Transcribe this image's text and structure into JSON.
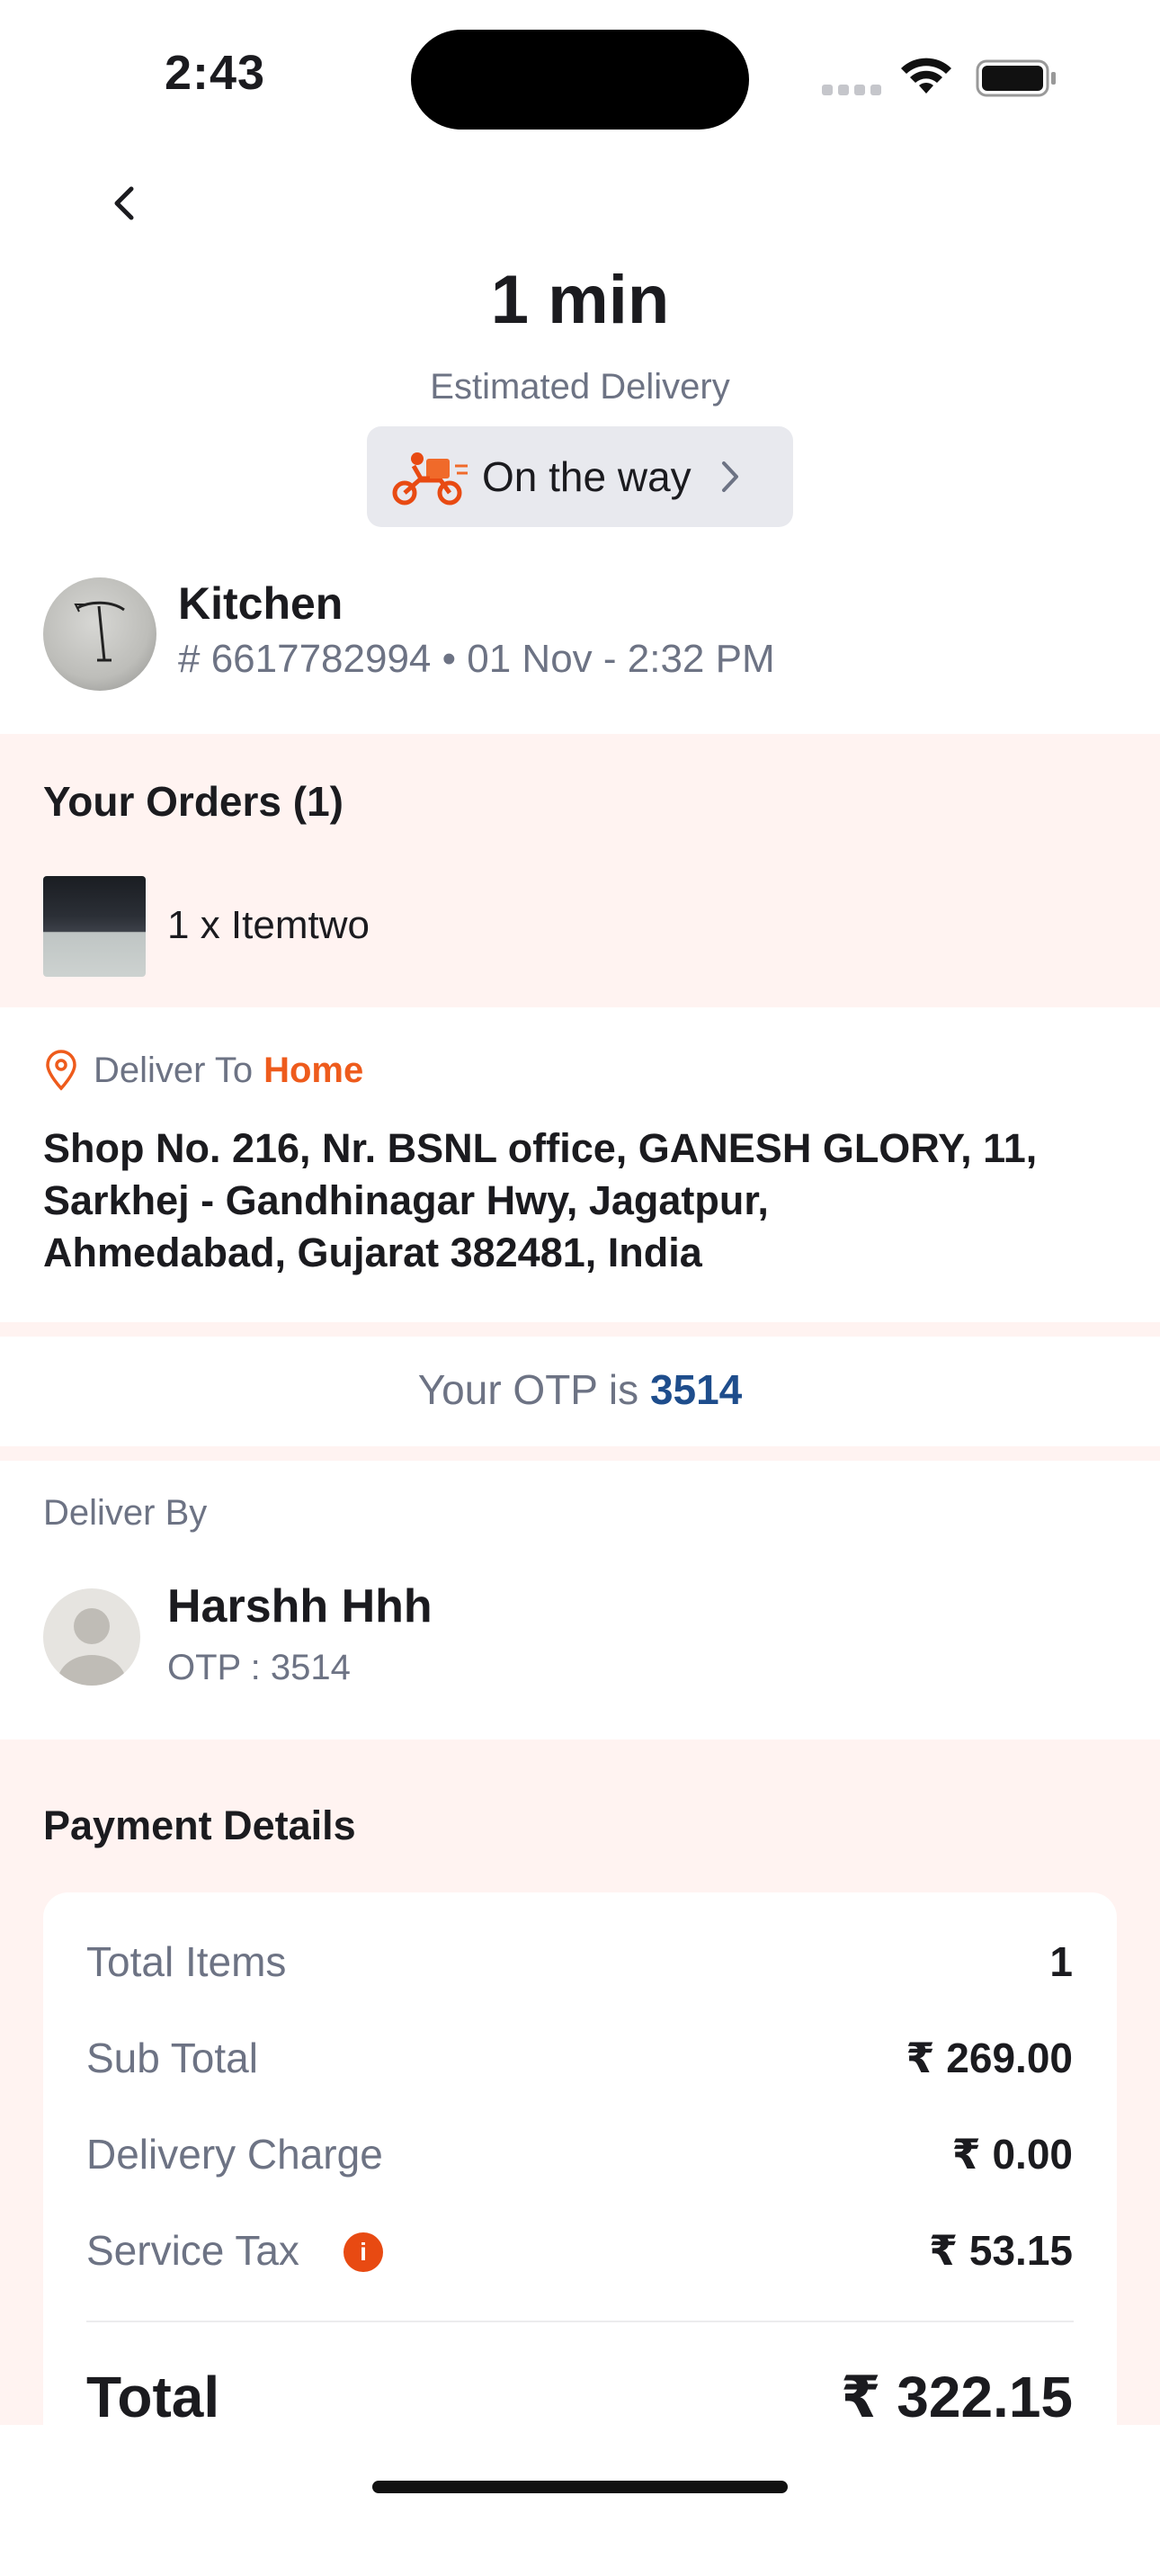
{
  "status_bar": {
    "time": "2:43"
  },
  "header": {
    "eta": "1 min",
    "eta_label": "Estimated Delivery",
    "status": "On the way"
  },
  "restaurant": {
    "name": "Kitchen",
    "order_meta": "# 6617782994 • 01 Nov - 2:32 PM"
  },
  "orders": {
    "title": "Your Orders (1)",
    "items": [
      {
        "text": "1 x Itemtwo"
      }
    ]
  },
  "delivery": {
    "label": "Deliver To",
    "place": "Home",
    "address_lines": [
      "Shop No. 216, Nr. BSNL office, GANESH GLORY, 11,",
      "Sarkhej - Gandhinagar Hwy, Jagatpur,",
      "Ahmedabad, Gujarat 382481, India"
    ]
  },
  "otp": {
    "prefix": "Your OTP is",
    "code": "3514"
  },
  "deliver_by": {
    "label": "Deliver By",
    "name": "Harshh Hhh",
    "otp": "OTP : 3514"
  },
  "payment": {
    "title": "Payment Details",
    "rows": [
      {
        "label": "Total Items",
        "value": "1"
      },
      {
        "label": "Sub Total",
        "value": "₹ 269.00"
      },
      {
        "label": "Delivery Charge",
        "value": "₹ 0.00"
      },
      {
        "label": "Service Tax",
        "value": "₹ 53.15"
      }
    ],
    "total_label": "Total",
    "total_value": "₹ 322.15"
  },
  "colors": {
    "accent": "#ee5b1c",
    "otp_code": "#1e4d8c",
    "section_tint": "#fff3f1",
    "muted_text": "#6d7384"
  },
  "icons": [
    "back-chevron-icon",
    "scooter-icon",
    "chevron-right-icon",
    "location-pin-icon",
    "info-icon",
    "avatar-placeholder-icon",
    "wifi-icon",
    "battery-icon"
  ]
}
